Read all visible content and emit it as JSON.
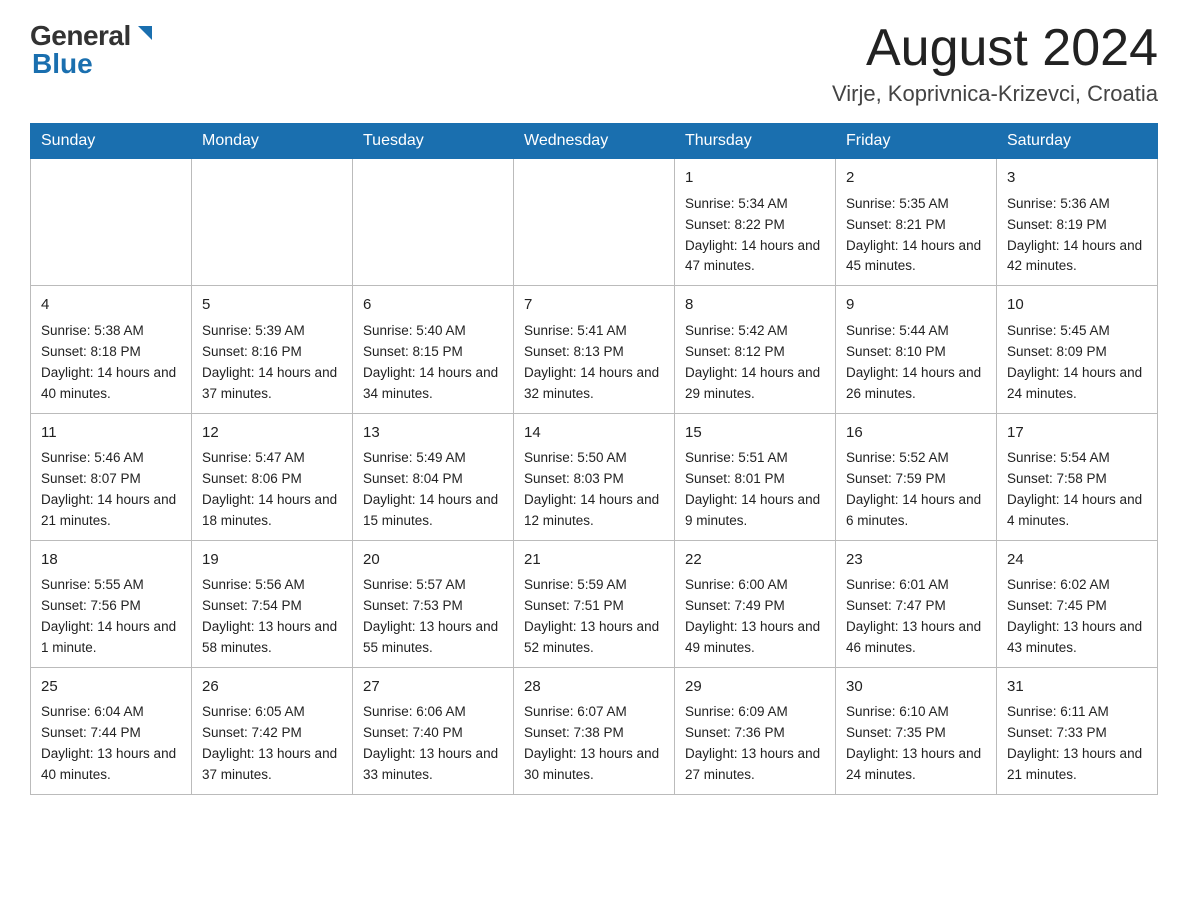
{
  "header": {
    "logo_general": "General",
    "logo_blue": "Blue",
    "month_title": "August 2024",
    "location": "Virje, Koprivnica-Krizevci, Croatia"
  },
  "days_of_week": [
    "Sunday",
    "Monday",
    "Tuesday",
    "Wednesday",
    "Thursday",
    "Friday",
    "Saturday"
  ],
  "weeks": [
    [
      {
        "day": "",
        "sunrise": "",
        "sunset": "",
        "daylight": ""
      },
      {
        "day": "",
        "sunrise": "",
        "sunset": "",
        "daylight": ""
      },
      {
        "day": "",
        "sunrise": "",
        "sunset": "",
        "daylight": ""
      },
      {
        "day": "",
        "sunrise": "",
        "sunset": "",
        "daylight": ""
      },
      {
        "day": "1",
        "sunrise": "Sunrise: 5:34 AM",
        "sunset": "Sunset: 8:22 PM",
        "daylight": "Daylight: 14 hours and 47 minutes."
      },
      {
        "day": "2",
        "sunrise": "Sunrise: 5:35 AM",
        "sunset": "Sunset: 8:21 PM",
        "daylight": "Daylight: 14 hours and 45 minutes."
      },
      {
        "day": "3",
        "sunrise": "Sunrise: 5:36 AM",
        "sunset": "Sunset: 8:19 PM",
        "daylight": "Daylight: 14 hours and 42 minutes."
      }
    ],
    [
      {
        "day": "4",
        "sunrise": "Sunrise: 5:38 AM",
        "sunset": "Sunset: 8:18 PM",
        "daylight": "Daylight: 14 hours and 40 minutes."
      },
      {
        "day": "5",
        "sunrise": "Sunrise: 5:39 AM",
        "sunset": "Sunset: 8:16 PM",
        "daylight": "Daylight: 14 hours and 37 minutes."
      },
      {
        "day": "6",
        "sunrise": "Sunrise: 5:40 AM",
        "sunset": "Sunset: 8:15 PM",
        "daylight": "Daylight: 14 hours and 34 minutes."
      },
      {
        "day": "7",
        "sunrise": "Sunrise: 5:41 AM",
        "sunset": "Sunset: 8:13 PM",
        "daylight": "Daylight: 14 hours and 32 minutes."
      },
      {
        "day": "8",
        "sunrise": "Sunrise: 5:42 AM",
        "sunset": "Sunset: 8:12 PM",
        "daylight": "Daylight: 14 hours and 29 minutes."
      },
      {
        "day": "9",
        "sunrise": "Sunrise: 5:44 AM",
        "sunset": "Sunset: 8:10 PM",
        "daylight": "Daylight: 14 hours and 26 minutes."
      },
      {
        "day": "10",
        "sunrise": "Sunrise: 5:45 AM",
        "sunset": "Sunset: 8:09 PM",
        "daylight": "Daylight: 14 hours and 24 minutes."
      }
    ],
    [
      {
        "day": "11",
        "sunrise": "Sunrise: 5:46 AM",
        "sunset": "Sunset: 8:07 PM",
        "daylight": "Daylight: 14 hours and 21 minutes."
      },
      {
        "day": "12",
        "sunrise": "Sunrise: 5:47 AM",
        "sunset": "Sunset: 8:06 PM",
        "daylight": "Daylight: 14 hours and 18 minutes."
      },
      {
        "day": "13",
        "sunrise": "Sunrise: 5:49 AM",
        "sunset": "Sunset: 8:04 PM",
        "daylight": "Daylight: 14 hours and 15 minutes."
      },
      {
        "day": "14",
        "sunrise": "Sunrise: 5:50 AM",
        "sunset": "Sunset: 8:03 PM",
        "daylight": "Daylight: 14 hours and 12 minutes."
      },
      {
        "day": "15",
        "sunrise": "Sunrise: 5:51 AM",
        "sunset": "Sunset: 8:01 PM",
        "daylight": "Daylight: 14 hours and 9 minutes."
      },
      {
        "day": "16",
        "sunrise": "Sunrise: 5:52 AM",
        "sunset": "Sunset: 7:59 PM",
        "daylight": "Daylight: 14 hours and 6 minutes."
      },
      {
        "day": "17",
        "sunrise": "Sunrise: 5:54 AM",
        "sunset": "Sunset: 7:58 PM",
        "daylight": "Daylight: 14 hours and 4 minutes."
      }
    ],
    [
      {
        "day": "18",
        "sunrise": "Sunrise: 5:55 AM",
        "sunset": "Sunset: 7:56 PM",
        "daylight": "Daylight: 14 hours and 1 minute."
      },
      {
        "day": "19",
        "sunrise": "Sunrise: 5:56 AM",
        "sunset": "Sunset: 7:54 PM",
        "daylight": "Daylight: 13 hours and 58 minutes."
      },
      {
        "day": "20",
        "sunrise": "Sunrise: 5:57 AM",
        "sunset": "Sunset: 7:53 PM",
        "daylight": "Daylight: 13 hours and 55 minutes."
      },
      {
        "day": "21",
        "sunrise": "Sunrise: 5:59 AM",
        "sunset": "Sunset: 7:51 PM",
        "daylight": "Daylight: 13 hours and 52 minutes."
      },
      {
        "day": "22",
        "sunrise": "Sunrise: 6:00 AM",
        "sunset": "Sunset: 7:49 PM",
        "daylight": "Daylight: 13 hours and 49 minutes."
      },
      {
        "day": "23",
        "sunrise": "Sunrise: 6:01 AM",
        "sunset": "Sunset: 7:47 PM",
        "daylight": "Daylight: 13 hours and 46 minutes."
      },
      {
        "day": "24",
        "sunrise": "Sunrise: 6:02 AM",
        "sunset": "Sunset: 7:45 PM",
        "daylight": "Daylight: 13 hours and 43 minutes."
      }
    ],
    [
      {
        "day": "25",
        "sunrise": "Sunrise: 6:04 AM",
        "sunset": "Sunset: 7:44 PM",
        "daylight": "Daylight: 13 hours and 40 minutes."
      },
      {
        "day": "26",
        "sunrise": "Sunrise: 6:05 AM",
        "sunset": "Sunset: 7:42 PM",
        "daylight": "Daylight: 13 hours and 37 minutes."
      },
      {
        "day": "27",
        "sunrise": "Sunrise: 6:06 AM",
        "sunset": "Sunset: 7:40 PM",
        "daylight": "Daylight: 13 hours and 33 minutes."
      },
      {
        "day": "28",
        "sunrise": "Sunrise: 6:07 AM",
        "sunset": "Sunset: 7:38 PM",
        "daylight": "Daylight: 13 hours and 30 minutes."
      },
      {
        "day": "29",
        "sunrise": "Sunrise: 6:09 AM",
        "sunset": "Sunset: 7:36 PM",
        "daylight": "Daylight: 13 hours and 27 minutes."
      },
      {
        "day": "30",
        "sunrise": "Sunrise: 6:10 AM",
        "sunset": "Sunset: 7:35 PM",
        "daylight": "Daylight: 13 hours and 24 minutes."
      },
      {
        "day": "31",
        "sunrise": "Sunrise: 6:11 AM",
        "sunset": "Sunset: 7:33 PM",
        "daylight": "Daylight: 13 hours and 21 minutes."
      }
    ]
  ]
}
